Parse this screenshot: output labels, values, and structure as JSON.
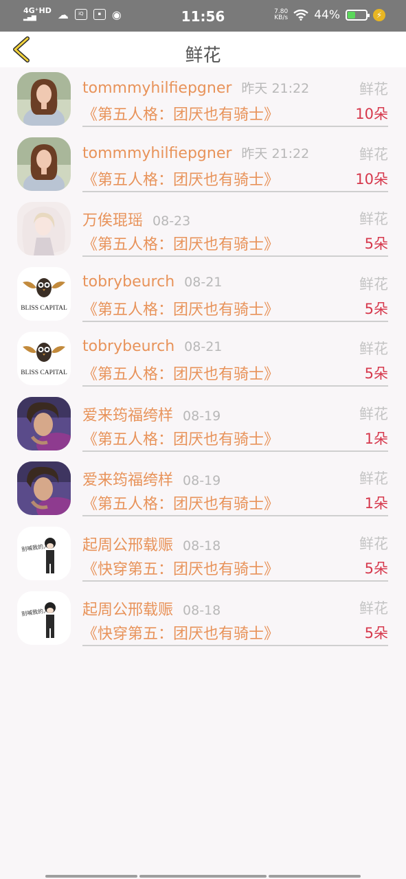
{
  "status_bar": {
    "network": "4G⁺HD",
    "time": "11:56",
    "speed_value": "7.80",
    "speed_unit": "KB/s",
    "battery_percent": "44%",
    "battery_level": 0.44
  },
  "nav": {
    "title": "鲜花"
  },
  "colors": {
    "name": "#e8935a",
    "count": "#d6384c",
    "muted": "#b8b8b8"
  },
  "entries": [
    {
      "avatar": "portrait-girl",
      "name": "tommmyhilfiepgner",
      "date": "昨天 21:22",
      "kind": "鲜花",
      "book": "《第五人格：团厌也有骑士》",
      "count": "10朵"
    },
    {
      "avatar": "portrait-girl",
      "name": "tommmyhilfiepgner",
      "date": "昨天 21:22",
      "kind": "鲜花",
      "book": "《第五人格：团厌也有骑士》",
      "count": "10朵"
    },
    {
      "avatar": "anime-girl",
      "name": "万俟琨瑶",
      "date": "08-23",
      "kind": "鲜花",
      "book": "《第五人格：团厌也有骑士》",
      "count": "5朵"
    },
    {
      "avatar": "owl-logo",
      "name": "tobrybeurch",
      "date": "08-21",
      "kind": "鲜花",
      "book": "《第五人格：团厌也有骑士》",
      "count": "5朵"
    },
    {
      "avatar": "owl-logo",
      "name": "tobrybeurch",
      "date": "08-21",
      "kind": "鲜花",
      "book": "《第五人格：团厌也有骑士》",
      "count": "5朵"
    },
    {
      "avatar": "portrait-boy",
      "name": "爱来筠福绔样",
      "date": "08-19",
      "kind": "鲜花",
      "book": "《第五人格：团厌也有骑士》",
      "count": "1朵"
    },
    {
      "avatar": "portrait-boy",
      "name": "爱来筠福绔样",
      "date": "08-19",
      "kind": "鲜花",
      "book": "《第五人格：团厌也有骑士》",
      "count": "1朵"
    },
    {
      "avatar": "cartoon-man",
      "name": "起周公邢载赈",
      "date": "08-18",
      "kind": "鲜花",
      "book": "《快穿第五：团厌也有骑士》",
      "count": "5朵"
    },
    {
      "avatar": "cartoon-man",
      "name": "起周公邢载赈",
      "date": "08-18",
      "kind": "鲜花",
      "book": "《快穿第五：团厌也有骑士》",
      "count": "5朵"
    }
  ],
  "avatar_art": {
    "owl_logo_text": "BLISS CAPITAL",
    "cartoon_text": "别喊我的人"
  }
}
